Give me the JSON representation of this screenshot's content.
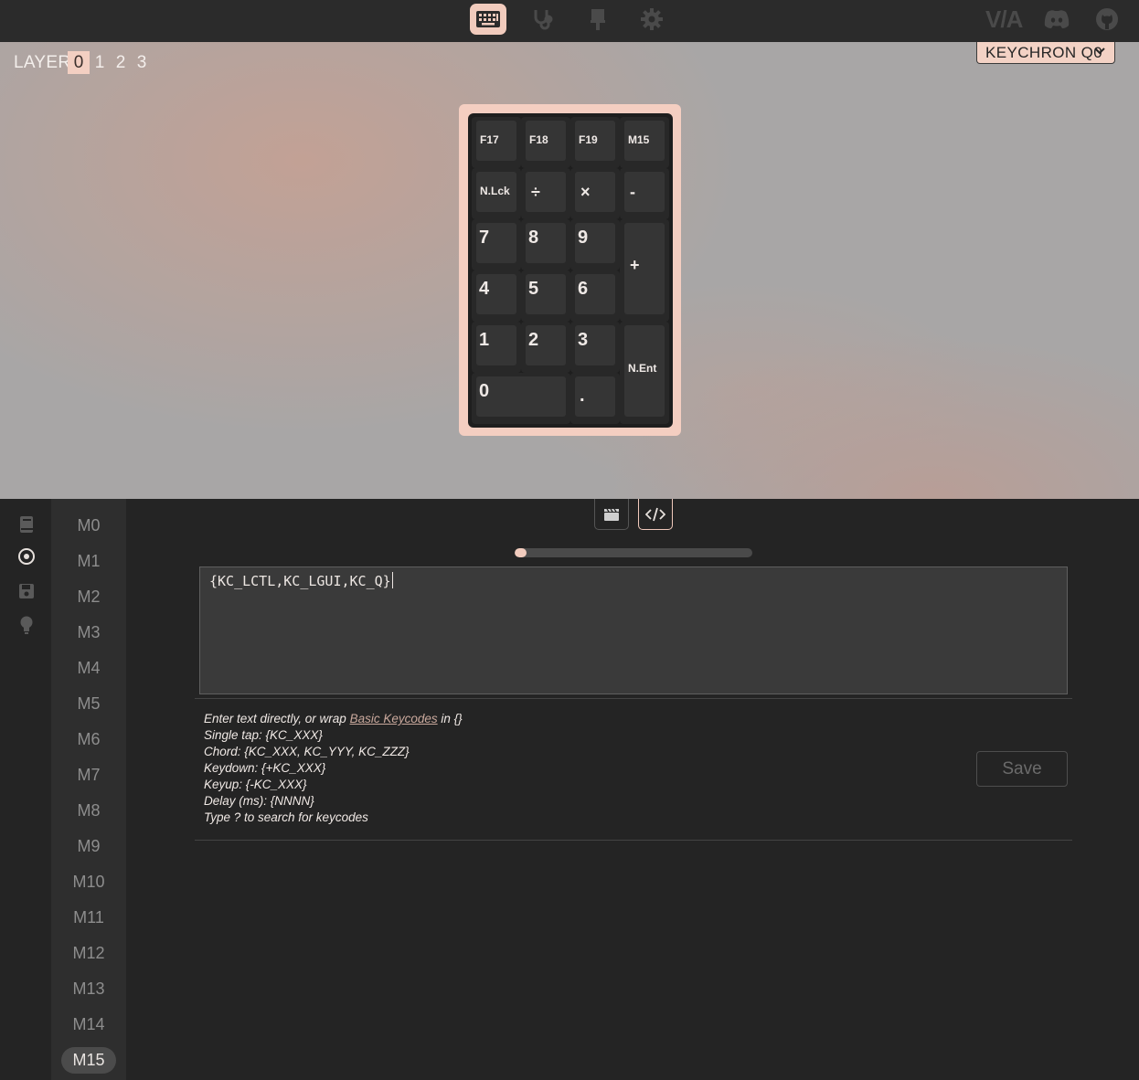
{
  "topnav": {
    "icons": [
      "keyboard-icon",
      "stethoscope-icon",
      "paintbrush-icon",
      "gear-icon"
    ],
    "right_icons": [
      "via-logo-icon",
      "discord-icon",
      "github-icon"
    ],
    "via_logo_text": "V/A"
  },
  "layers": {
    "label": "LAYER",
    "items": [
      "0",
      "1",
      "2",
      "3"
    ],
    "active": "0"
  },
  "device": {
    "name": "KEYCHRON Q0"
  },
  "keyboard": {
    "keys": [
      {
        "label": "F17"
      },
      {
        "label": "F18"
      },
      {
        "label": "F19"
      },
      {
        "label": "M15"
      },
      {
        "label": "N.Lck"
      },
      {
        "label": "÷"
      },
      {
        "label": "×"
      },
      {
        "label": "-"
      },
      {
        "label": "7"
      },
      {
        "label": "8"
      },
      {
        "label": "9"
      },
      {
        "label": "+"
      },
      {
        "label": "4"
      },
      {
        "label": "5"
      },
      {
        "label": "6"
      },
      {
        "label": "1"
      },
      {
        "label": "2"
      },
      {
        "label": "3"
      },
      {
        "label": "N.Ent"
      },
      {
        "label": "0"
      },
      {
        "label": "."
      }
    ]
  },
  "side_menu": {
    "icons": [
      "book-icon",
      "target-icon",
      "save-icon",
      "lightbulb-icon"
    ],
    "active": "target-icon"
  },
  "macros": {
    "items": [
      "M0",
      "M1",
      "M2",
      "M3",
      "M4",
      "M5",
      "M6",
      "M7",
      "M8",
      "M9",
      "M10",
      "M11",
      "M12",
      "M13",
      "M14",
      "M15"
    ],
    "active": "M15"
  },
  "editor": {
    "modes": [
      "clapperboard-icon",
      "code-icon"
    ],
    "active_mode": "code-icon",
    "progress": 0.05,
    "value": "{KC_LCTL,KC_LGUI,KC_Q}",
    "help": {
      "line1_pre": "Enter text directly, or wrap ",
      "line1_link": "Basic Keycodes",
      "line1_post": " in {}",
      "single_tap": "Single tap: {KC_XXX}",
      "chord": "Chord: {KC_XXX, KC_YYY, KC_ZZZ}",
      "keydown": "Keydown: {+KC_XXX}",
      "keyup": "Keyup: {-KC_XXX}",
      "delay": "Delay (ms): {NNNN}",
      "search": "Type ? to search for keycodes"
    },
    "save_label": "Save"
  }
}
